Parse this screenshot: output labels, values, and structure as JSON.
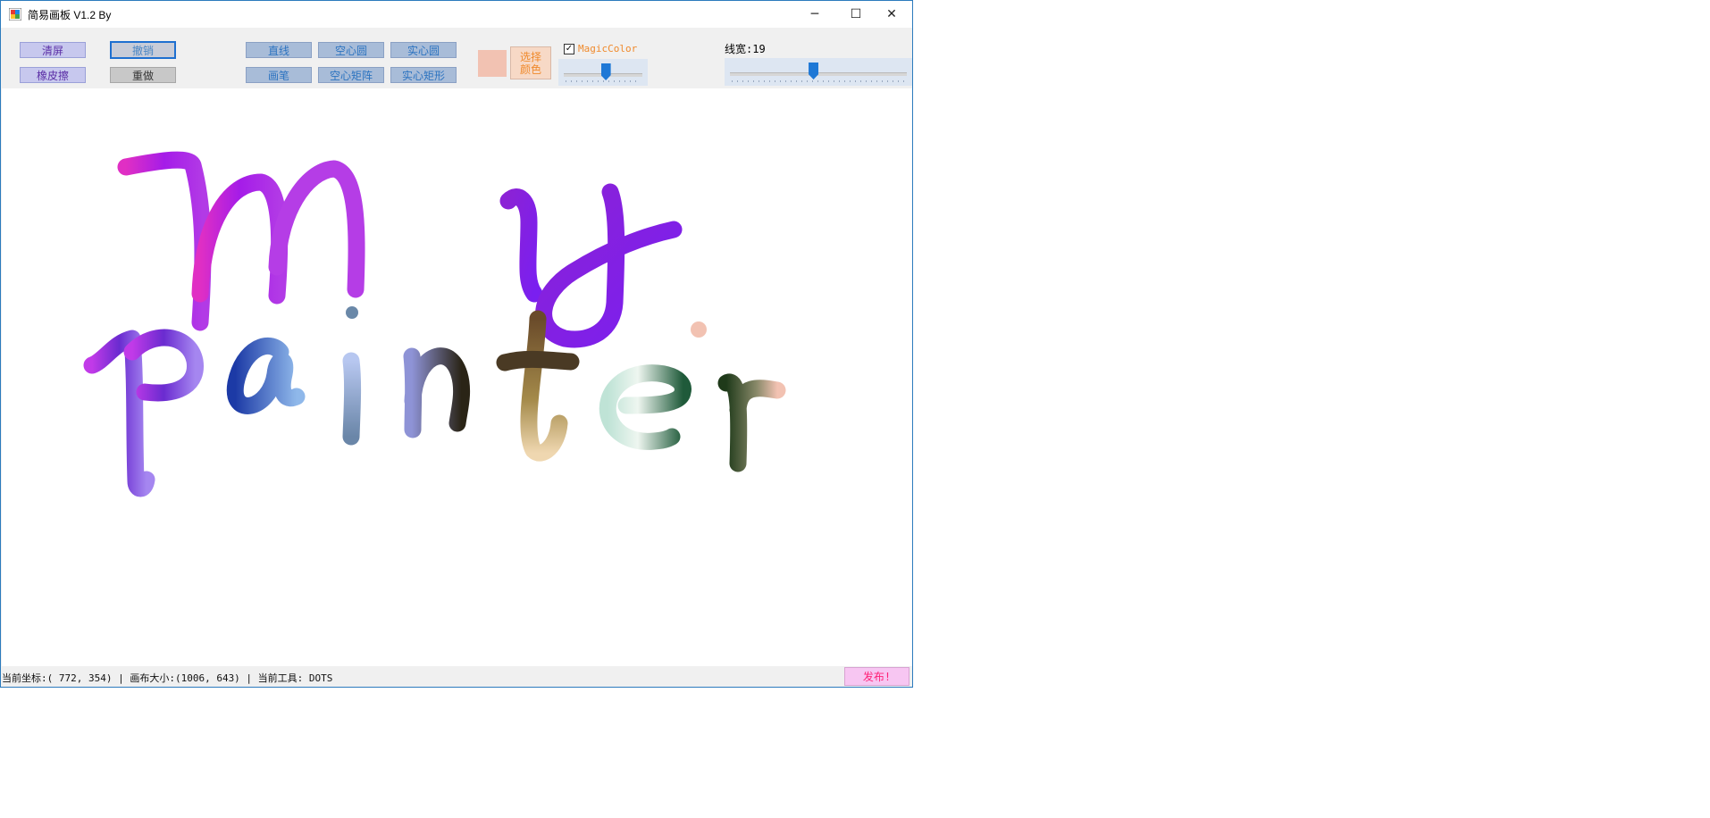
{
  "window": {
    "title": "简易画板 V1.2 By",
    "minimize_glyph": "─",
    "maximize_glyph": "☐",
    "close_glyph": "✕",
    "icon": "paint-app-icon"
  },
  "toolbar": {
    "clear": "清屏",
    "eraser": "橡皮擦",
    "undo": "撤销",
    "redo": "重做",
    "line": "直线",
    "pen": "画笔",
    "hollow_circle": "空心圆",
    "hollow_rect": "空心矩阵",
    "solid_circle": "实心圆",
    "solid_rect": "实心矩形",
    "current_color": "#f2c2b2",
    "pick_color_line1": "选择",
    "pick_color_line2": "颜色",
    "magic_color_label": "MagicColor",
    "magic_color_checked": true,
    "magic_slider_level": 0.53,
    "line_width_label": "线宽:19",
    "line_width_level": 0.47
  },
  "statusbar": {
    "text": "当前坐标:( 772, 354) | 画布大小:(1006, 643) | 当前工具: DOTS",
    "publish": "发布!"
  },
  "colors": {
    "accent": "#1e78d6",
    "publish_text": "#ff2277",
    "magic_text": "#f08a2c"
  }
}
